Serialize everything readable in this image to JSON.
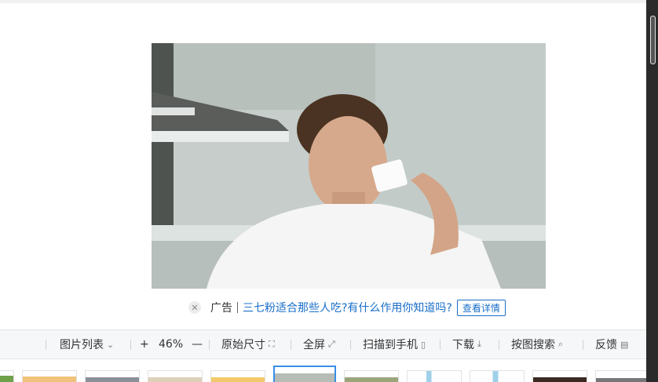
{
  "ad": {
    "close_icon": "close-icon",
    "tag": "广告",
    "text": "三七粉适合那些人吃?有什么作用你知道吗?",
    "button": "查看详情"
  },
  "toolbar": {
    "list": "图片列表",
    "zoom_in": "+",
    "zoom": "46%",
    "zoom_out": "—",
    "original": "原始尺寸",
    "fullscreen": "全屏",
    "scan": "扫描到手机",
    "download": "下载",
    "search": "按图搜索",
    "feedback": "反馈"
  },
  "colors": {
    "accent": "#3a8ee6",
    "link": "#1a6fc9"
  }
}
